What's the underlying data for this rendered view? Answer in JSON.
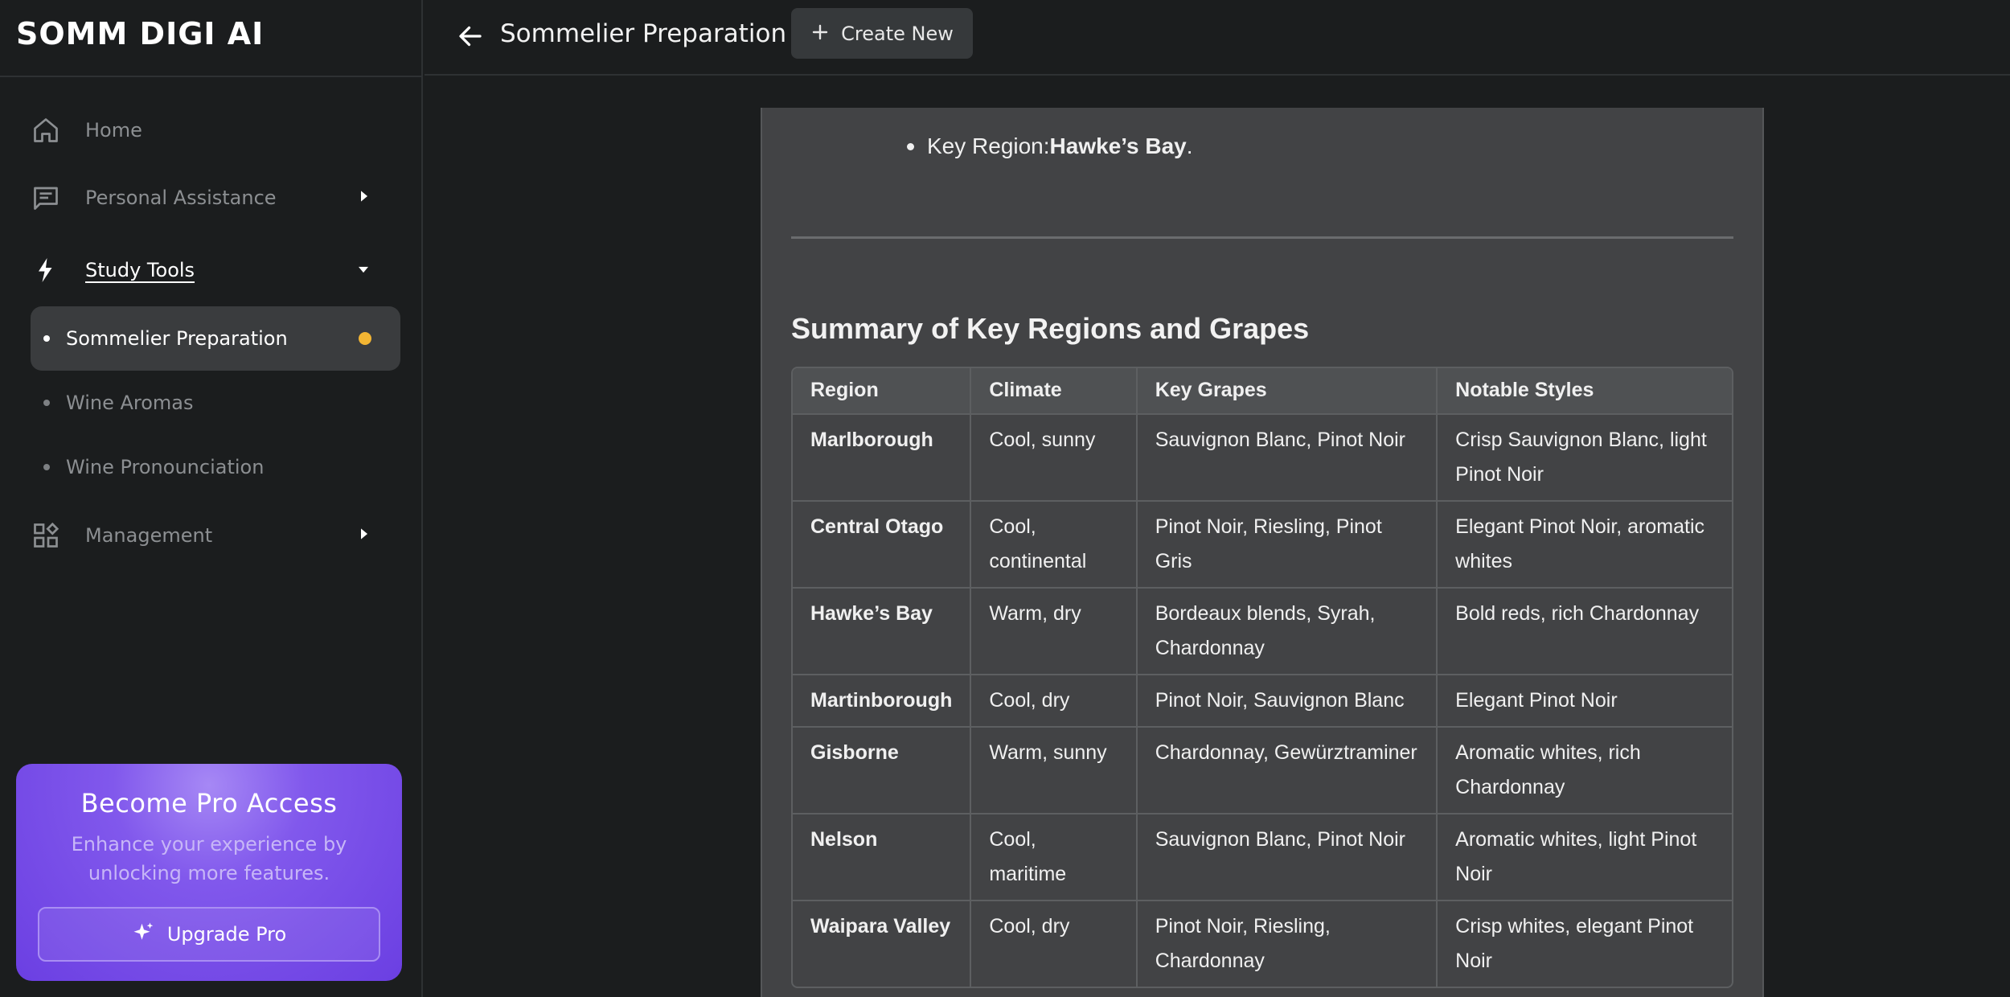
{
  "app": {
    "brand": "SOMM DIGI AI"
  },
  "sidebar": {
    "items": [
      {
        "label": "Home",
        "icon": "home-icon"
      },
      {
        "label": "Personal Assistance",
        "icon": "chat-icon"
      },
      {
        "label": "Study Tools",
        "icon": "bolt-icon"
      },
      {
        "label": "Management",
        "icon": "grid-icon"
      }
    ],
    "study_tools": [
      {
        "label": "Sommelier Preparation"
      },
      {
        "label": "Wine Aromas"
      },
      {
        "label": "Wine Pronounciation"
      }
    ],
    "promo": {
      "title": "Become Pro Access",
      "subtitle": "Enhance your experience by unlocking more features.",
      "button_label": "Upgrade Pro"
    }
  },
  "topbar": {
    "title": "Sommelier Preparation",
    "create_label": "Create New"
  },
  "content": {
    "bullet_prefix": "Key Region: ",
    "bullet_bold": "Hawke’s Bay",
    "bullet_suffix": ".",
    "section_title": "Summary of Key Regions and Grapes",
    "table": {
      "headers": [
        "Region",
        "Climate",
        "Key Grapes",
        "Notable Styles"
      ],
      "rows": [
        [
          "Marlborough",
          "Cool, sunny",
          "Sauvignon Blanc, Pinot Noir",
          "Crisp Sauvignon Blanc, light Pinot Noir"
        ],
        [
          "Central Otago",
          "Cool, continental",
          "Pinot Noir, Riesling, Pinot Gris",
          "Elegant Pinot Noir, aromatic whites"
        ],
        [
          "Hawke’s Bay",
          "Warm, dry",
          "Bordeaux blends, Syrah, Chardonnay",
          "Bold reds, rich Chardonnay"
        ],
        [
          "Martinborough",
          "Cool, dry",
          "Pinot Noir, Sauvignon Blanc",
          "Elegant Pinot Noir"
        ],
        [
          "Gisborne",
          "Warm, sunny",
          "Chardonnay, Gewürztraminer",
          "Aromatic whites, rich Chardonnay"
        ],
        [
          "Nelson",
          "Cool, maritime",
          "Sauvignon Blanc, Pinot Noir",
          "Aromatic whites, light Pinot Noir"
        ],
        [
          "Waipara Valley",
          "Cool, dry",
          "Pinot Noir, Riesling, Chardonnay",
          "Crisp whites, elegant Pinot Noir"
        ]
      ]
    }
  },
  "colors": {
    "background": "#1b1d1e",
    "card": "#424345",
    "accent_dot": "#f2b533",
    "promo": "#7a4fe8"
  }
}
